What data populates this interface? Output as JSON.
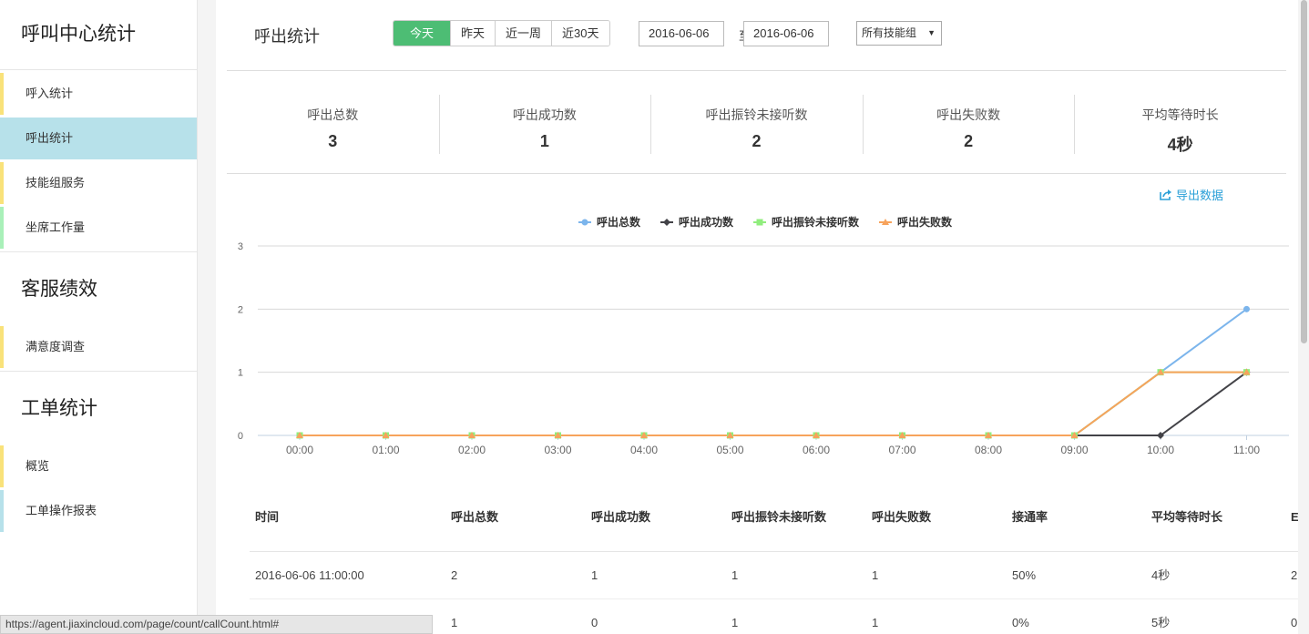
{
  "sidebar": {
    "sections": [
      {
        "title": "呼叫中心统计",
        "items": [
          "呼入统计",
          "呼出统计",
          "技能组服务",
          "坐席工作量"
        ]
      },
      {
        "title": "客服绩效",
        "items": [
          "满意度调查"
        ]
      },
      {
        "title": "工单统计",
        "items": [
          "概览",
          "工单操作报表"
        ]
      }
    ]
  },
  "header": {
    "title": "呼出统计",
    "ranges": [
      "今天",
      "昨天",
      "近一周",
      "近30天"
    ],
    "date_from": "2016-06-06",
    "date_sep": "至",
    "date_to": "2016-06-06",
    "skill_group": "所有技能组",
    "caret": "▼"
  },
  "stats": [
    {
      "label": "呼出总数",
      "value": "3"
    },
    {
      "label": "呼出成功数",
      "value": "1"
    },
    {
      "label": "呼出振铃未接听数",
      "value": "2"
    },
    {
      "label": "呼出失败数",
      "value": "2"
    },
    {
      "label": "平均等待时长",
      "value": "4秒"
    }
  ],
  "export_label": "导出数据",
  "chart_data": {
    "type": "line",
    "x": [
      "00:00",
      "01:00",
      "02:00",
      "03:00",
      "04:00",
      "05:00",
      "06:00",
      "07:00",
      "08:00",
      "09:00",
      "10:00",
      "11:00"
    ],
    "ylim": [
      0,
      3
    ],
    "yticks": [
      0,
      1,
      2,
      3
    ],
    "grid": true,
    "legend": "top-center",
    "series": [
      {
        "name": "呼出总数",
        "color": "#7cb5ec",
        "marker": "circle",
        "values": [
          0,
          0,
          0,
          0,
          0,
          0,
          0,
          0,
          0,
          0,
          1,
          2
        ]
      },
      {
        "name": "呼出成功数",
        "color": "#434348",
        "marker": "diamond",
        "values": [
          0,
          0,
          0,
          0,
          0,
          0,
          0,
          0,
          0,
          0,
          0,
          1
        ]
      },
      {
        "name": "呼出振铃未接听数",
        "color": "#90ed7d",
        "marker": "square",
        "values": [
          0,
          0,
          0,
          0,
          0,
          0,
          0,
          0,
          0,
          0,
          1,
          1
        ]
      },
      {
        "name": "呼出失败数",
        "color": "#f7a35c",
        "marker": "triangle",
        "values": [
          0,
          0,
          0,
          0,
          0,
          0,
          0,
          0,
          0,
          0,
          1,
          1
        ]
      }
    ]
  },
  "table": {
    "headers": [
      "时间",
      "呼出总数",
      "呼出成功数",
      "呼出振铃未接听数",
      "呼出失败数",
      "接通率",
      "平均等待时长",
      "E"
    ],
    "rows": [
      [
        "2016-06-06 11:00:00",
        "2",
        "1",
        "1",
        "1",
        "50%",
        "4秒",
        "2"
      ],
      [
        "",
        "1",
        "0",
        "1",
        "1",
        "0%",
        "5秒",
        "0"
      ]
    ]
  },
  "status_url": "https://agent.jiaxincloud.com/page/count/callCount.html#",
  "colors": {
    "accent": "#4dbd74",
    "active_nav": "#b7e1ea",
    "link": "#2ba0d8"
  }
}
